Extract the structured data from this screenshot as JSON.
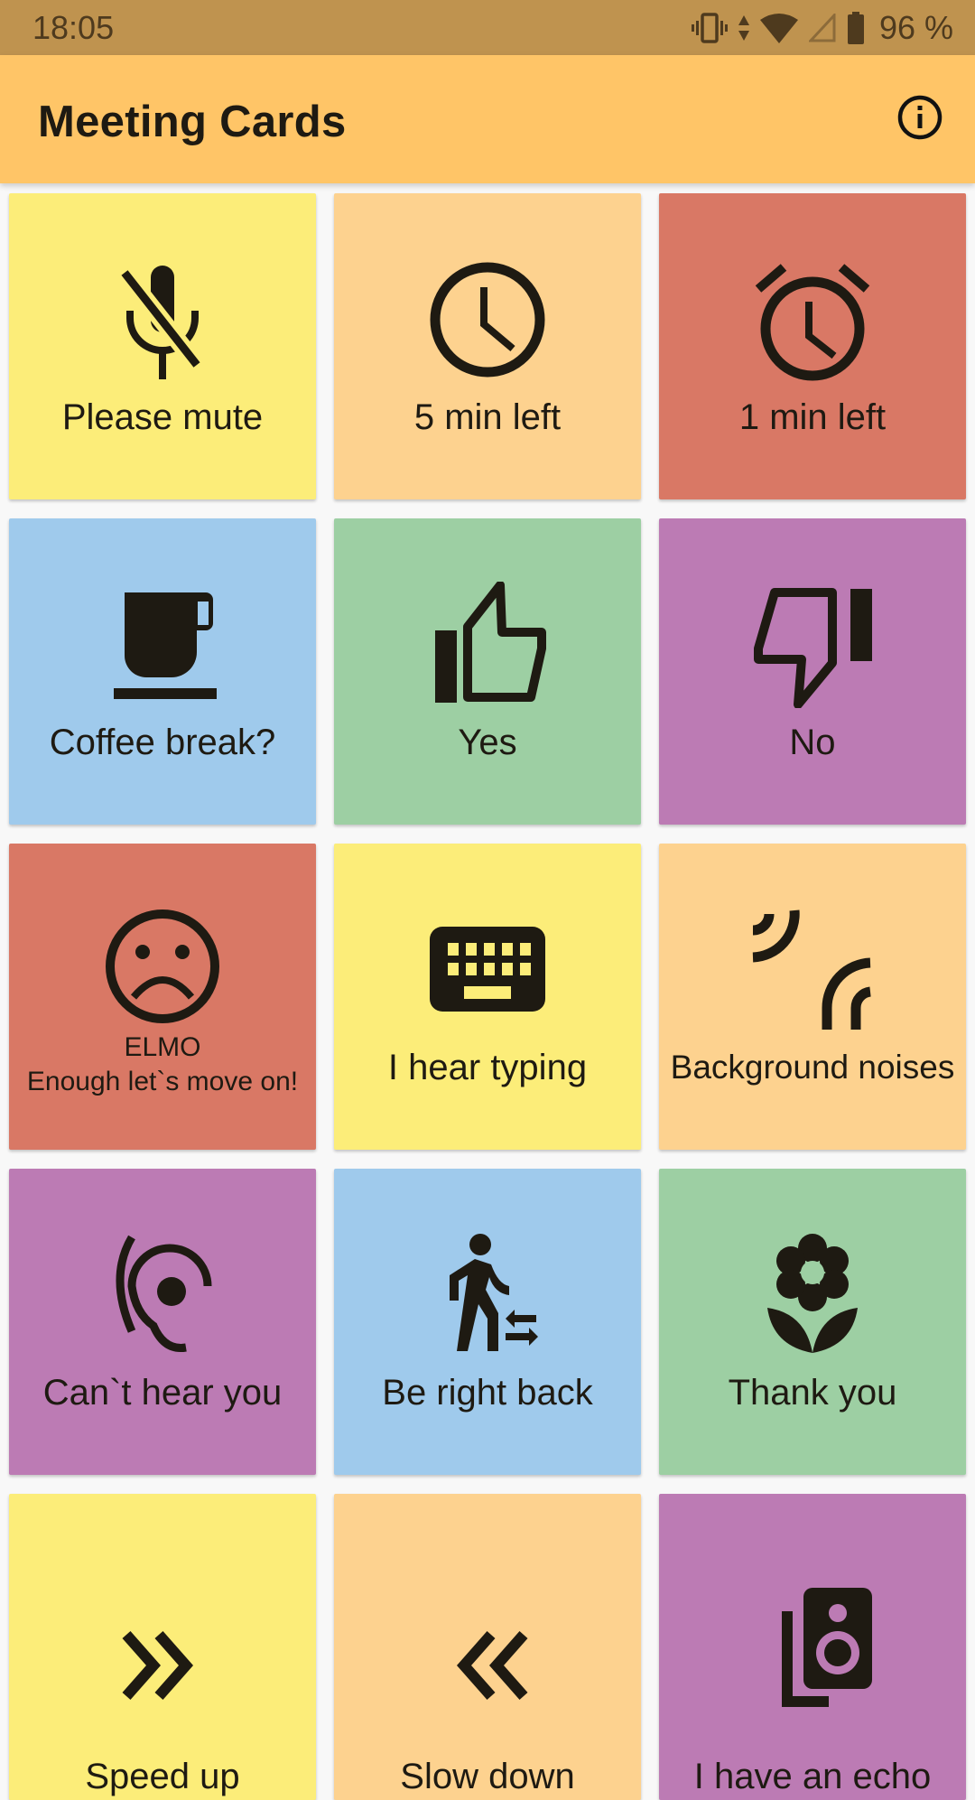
{
  "status_bar": {
    "time": "18:05",
    "icons": [
      "vibrate-icon",
      "data-arrows-icon",
      "wifi-icon",
      "cell-signal-empty-icon",
      "battery-icon"
    ],
    "battery_percent": "96 %"
  },
  "app_bar": {
    "title": "Meeting Cards",
    "info_icon": "info-icon"
  },
  "colors": {
    "status_bar": "#BF934F",
    "app_bar": "#FFC567",
    "background": "#F8F8F8",
    "yellow": "#FCED79",
    "peach": "#FDD28F",
    "red": "#D97865",
    "blue": "#9FCAEC",
    "green": "#9DCFA3",
    "purple": "#BC7BB4"
  },
  "cards": [
    {
      "label": "Please mute",
      "icon": "mic-off-icon",
      "color": "#FCED79"
    },
    {
      "label": "5 min left",
      "icon": "clock-icon",
      "color": "#FDD28F"
    },
    {
      "label": "1 min left",
      "icon": "alarm-icon",
      "color": "#D97865"
    },
    {
      "label": "Coffee break?",
      "icon": "coffee-icon",
      "color": "#9FCAEC"
    },
    {
      "label": "Yes",
      "icon": "thumbs-up-icon",
      "color": "#9DCFA3"
    },
    {
      "label": "No",
      "icon": "thumbs-down-icon",
      "color": "#BC7BB4"
    },
    {
      "label": "ELMO",
      "sublabel": "Enough let`s move on!",
      "icon": "sad-face-icon",
      "color": "#D97865"
    },
    {
      "label": "I hear typing",
      "icon": "keyboard-icon",
      "color": "#FCED79"
    },
    {
      "label": "Background noises",
      "icon": "noise-waves-icon",
      "color": "#FDD28F"
    },
    {
      "label": "Can`t hear you",
      "icon": "hearing-icon",
      "color": "#BC7BB4"
    },
    {
      "label": "Be right back",
      "icon": "walk-away-icon",
      "color": "#9FCAEC"
    },
    {
      "label": "Thank you",
      "icon": "flower-icon",
      "color": "#9DCFA3"
    },
    {
      "label": "Speed up",
      "icon": "double-chevron-right-icon",
      "color": "#FCED79"
    },
    {
      "label": "Slow down",
      "icon": "double-chevron-left-icon",
      "color": "#FDD28F"
    },
    {
      "label": "I have an echo",
      "icon": "speaker-icon",
      "color": "#BC7BB4"
    }
  ]
}
